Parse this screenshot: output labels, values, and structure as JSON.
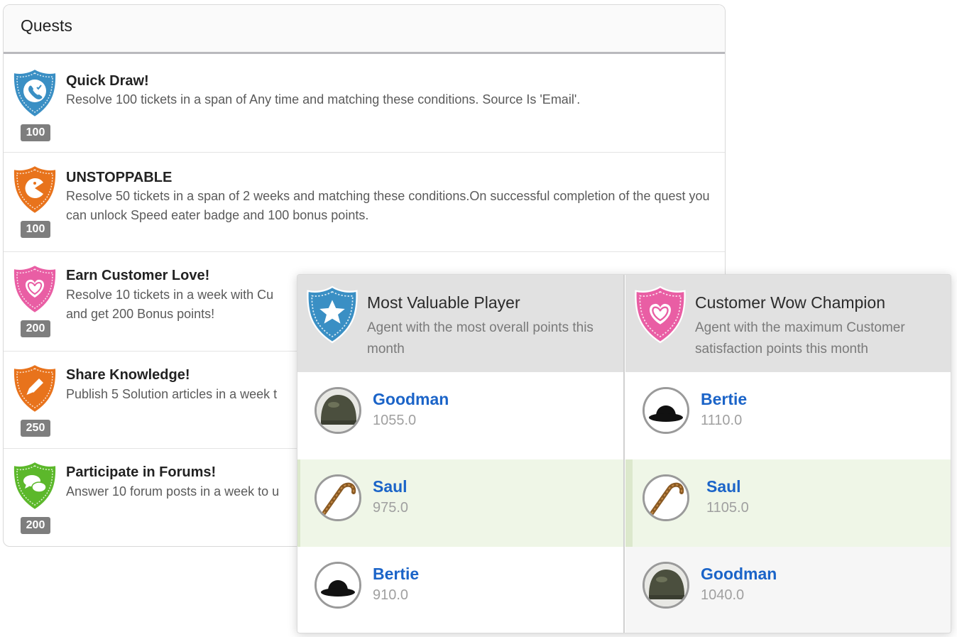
{
  "quests": {
    "title": "Quests",
    "items": [
      {
        "name": "Quick Draw!",
        "description": "Resolve 100 tickets in a span of Any time and matching these conditions. Source Is 'Email'.",
        "points": "100",
        "badge_icon": "phone-check-shield-icon",
        "badge_color": "#3a8fc4"
      },
      {
        "name": "UNSTOPPABLE",
        "description": "Resolve 50 tickets in a span of 2 weeks and matching these conditions.On successful completion of the quest you can unlock Speed eater badge and 100 bonus points.",
        "points": "100",
        "badge_icon": "chomper-shield-icon",
        "badge_color": "#e8731c"
      },
      {
        "name": "Earn Customer Love!",
        "description": "Resolve 10 tickets in a week with Cu",
        "description_line2": "and get 200 Bonus points!",
        "points": "200",
        "badge_icon": "heart-shield-icon",
        "badge_color": "#e95ea4"
      },
      {
        "name": "Share Knowledge!",
        "description": "Publish 5 Solution articles in a week t",
        "points": "250",
        "badge_icon": "pen-shield-icon",
        "badge_color": "#e8731c"
      },
      {
        "name": "Participate in Forums!",
        "description": "Answer 10 forum posts in a week to u",
        "points": "200",
        "badge_icon": "chat-bubbles-shield-icon",
        "badge_color": "#5cb82b"
      }
    ]
  },
  "leaderboards": [
    {
      "title": "Most Valuable Player",
      "subtitle": "Agent with the most overall points this month",
      "badge_icon": "star-shield-icon",
      "badge_color": "#3a8fc4",
      "entries": [
        {
          "name": "Goodman",
          "score": "1055.0",
          "avatar_icon": "helmet-avatar-icon"
        },
        {
          "name": "Saul",
          "score": "975.0",
          "avatar_icon": "cane-avatar-icon"
        },
        {
          "name": "Bertie",
          "score": "910.0",
          "avatar_icon": "bowler-hat-avatar-icon"
        }
      ]
    },
    {
      "title": "Customer Wow Champion",
      "subtitle": "Agent with the maximum Customer satisfaction points this month",
      "badge_icon": "heart-shield-icon",
      "badge_color": "#e95ea4",
      "entries": [
        {
          "name": "Bertie",
          "score": "1110.0",
          "avatar_icon": "bowler-hat-avatar-icon"
        },
        {
          "name": "Saul",
          "score": "1105.0",
          "avatar_icon": "cane-avatar-icon"
        },
        {
          "name": "Goodman",
          "score": "1040.0",
          "avatar_icon": "helmet-avatar-icon"
        }
      ]
    }
  ]
}
